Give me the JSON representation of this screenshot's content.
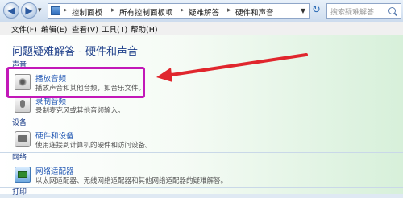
{
  "nav": {
    "back_icon": "back-arrow-icon",
    "forward_icon": "forward-arrow-icon",
    "breadcrumbs": [
      "控制面板",
      "所有控制面板项",
      "疑难解答",
      "硬件和声音"
    ],
    "separator": "▸",
    "refresh_icon": "refresh-icon",
    "search_placeholder": "搜索疑难解答"
  },
  "menu": {
    "items": [
      "文件(F)",
      "编辑(E)",
      "查看(V)",
      "工具(T)",
      "帮助(H)"
    ]
  },
  "page": {
    "title": "问题疑难解答 - 硬件和声音"
  },
  "sections": [
    {
      "heading": "声音",
      "items": [
        {
          "title": "播放音频",
          "desc": "播放声音和其他音频，如音乐文件。",
          "icon": "speaker-icon"
        },
        {
          "title": "录制音频",
          "desc": "录制麦克风或其他音频输入。",
          "icon": "microphone-icon"
        }
      ]
    },
    {
      "heading": "设备",
      "items": [
        {
          "title": "硬件和设备",
          "desc": "使用连接到计算机的硬件和访问设备。",
          "icon": "hardware-device-icon"
        }
      ]
    },
    {
      "heading": "网络",
      "items": [
        {
          "title": "网络适配器",
          "desc": "以太网适配器、无线网络适配器和其他网络适配器的疑难解答。",
          "icon": "network-adapter-icon"
        }
      ]
    },
    {
      "heading": "打印",
      "items": []
    }
  ],
  "annotation": {
    "highlight_color": "#c218b8",
    "arrow_color": "#e0262d"
  }
}
